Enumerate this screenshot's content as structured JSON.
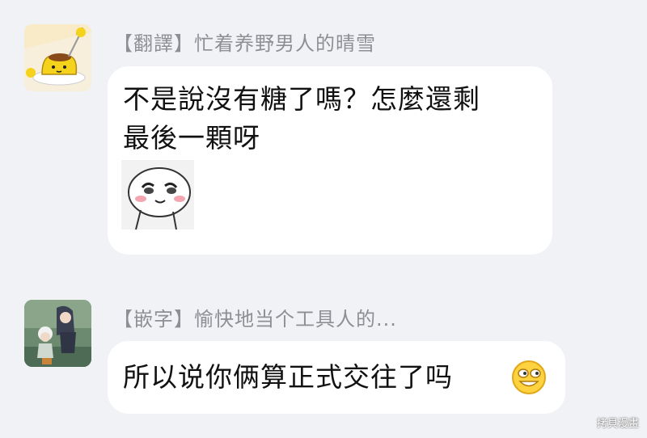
{
  "messages": [
    {
      "sender": "【翻譯】忙着养野男人的晴雪",
      "lines": [
        "不是說沒有糖了嗎？怎麼還剩",
        "最後一顆呀"
      ],
      "sticker": "blushing-face-sticker",
      "avatar": "pudding-avatar"
    },
    {
      "sender": "【嵌字】愉快地当个工具人的...",
      "lines": [
        "所以说你俩算正式交往了吗"
      ],
      "emoji": "grinning-face-emoji",
      "avatar": "anime-characters-avatar"
    }
  ],
  "watermark": "拷貝漫畫",
  "colors": {
    "background": "#f1f2f6",
    "bubble": "#ffffff",
    "sender_text": "#8e8f94",
    "message_text": "#111111"
  }
}
